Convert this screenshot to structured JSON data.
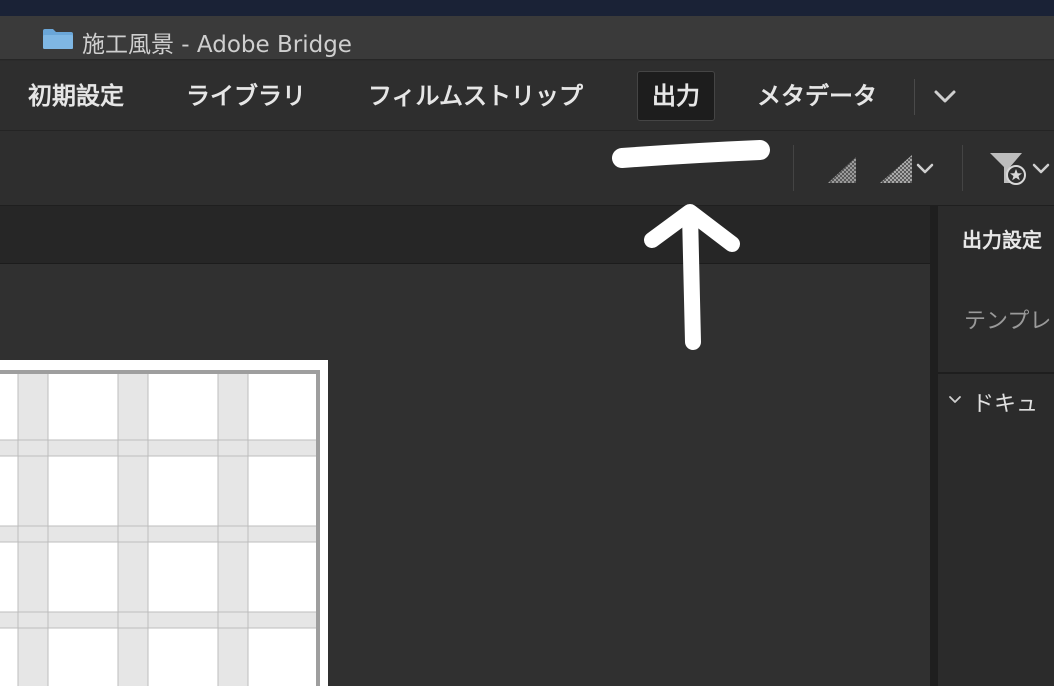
{
  "window": {
    "title": "施工風景 - Adobe Bridge",
    "folder_icon": "folder-icon"
  },
  "workspaces": {
    "tabs": [
      {
        "label": "初期設定"
      },
      {
        "label": "ライブラリ"
      },
      {
        "label": "フィルムストリップ"
      },
      {
        "label": "出力",
        "active": true
      },
      {
        "label": "メタデータ"
      }
    ],
    "more_icon": "chevron-down-icon"
  },
  "toolbar": {
    "icons": [
      "sort-quality-icon",
      "thumbnail-quality-icon",
      "filter-rating-icon"
    ]
  },
  "right_panel": {
    "title": "出力設定",
    "template_label": "テンプレ",
    "document_section": "ドキュ"
  },
  "colors": {
    "accent_folder": "#6aa6d8",
    "background": "#2b2b2b",
    "annotation": "#ffffff"
  }
}
